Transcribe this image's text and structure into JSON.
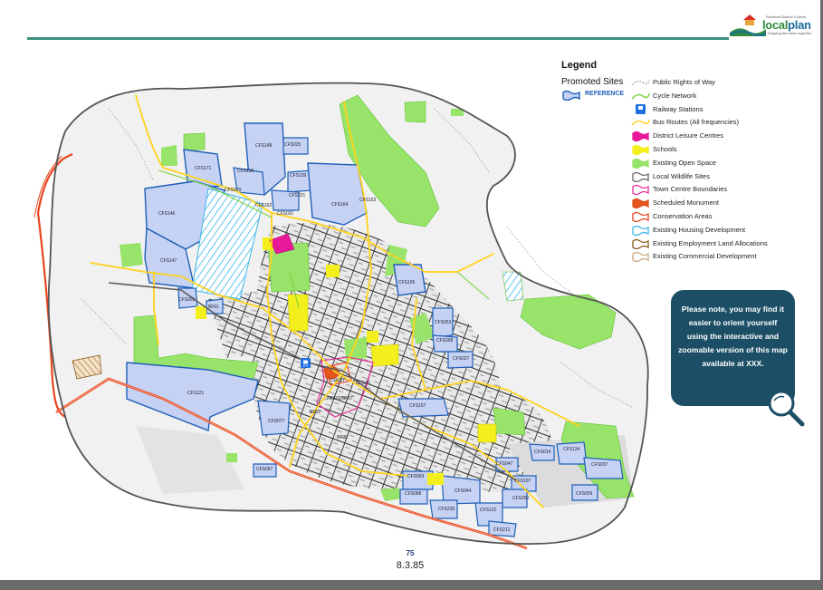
{
  "logo": {
    "tagline_top": "Rochford District Council",
    "wordmark_a": "local",
    "wordmark_b": "plan",
    "tagline": "Shaping the future together"
  },
  "legend": {
    "title": "Legend",
    "promoted_sites_title": "Promoted Sites",
    "promoted_sites_ref": "REFERENCE",
    "items": [
      {
        "label": "Public Rights of Way",
        "symbol": "dotted-line",
        "color": "#9a9a9a"
      },
      {
        "label": "Cycle Network",
        "symbol": "line",
        "color": "#7ad13a"
      },
      {
        "label": "Railway Stations",
        "symbol": "train-icon",
        "color": "#1f6fe0"
      },
      {
        "label": "Bus Routes (All frequencies)",
        "symbol": "line",
        "color": "#ffd21a"
      },
      {
        "label": "District Leisure Centres",
        "symbol": "area",
        "color": "#e8189a"
      },
      {
        "label": "Schools",
        "symbol": "area",
        "color": "#f3ef1c"
      },
      {
        "label": "Existing Open Space",
        "symbol": "area",
        "color": "#98e46a"
      },
      {
        "label": "Local Wildlife Sites",
        "symbol": "outline",
        "color": "#666666"
      },
      {
        "label": "Town Centre Boundaries",
        "symbol": "outline",
        "color": "#e52c9a"
      },
      {
        "label": "Scheduled Monument",
        "symbol": "area",
        "color": "#e0561e"
      },
      {
        "label": "Conservation Areas",
        "symbol": "outline",
        "color": "#e8451f"
      },
      {
        "label": "Existing Housing Development",
        "symbol": "outline",
        "color": "#3bb4e8"
      },
      {
        "label": "Existing Employment Land Allocations",
        "symbol": "outline",
        "color": "#8a5a1e"
      },
      {
        "label": "Existing Commercial Development",
        "symbol": "outline",
        "color": "#c8a880"
      }
    ]
  },
  "sites": [
    {
      "ref": "CFS148"
    },
    {
      "ref": "CFS025"
    },
    {
      "ref": "CFS171"
    },
    {
      "ref": "CFS136"
    },
    {
      "ref": "CFS139"
    },
    {
      "ref": "CFS170"
    },
    {
      "ref": "CFS221"
    },
    {
      "ref": "CFS162"
    },
    {
      "ref": "CFS164"
    },
    {
      "ref": "CFS163"
    },
    {
      "ref": "CFS146"
    },
    {
      "ref": "CFS031"
    },
    {
      "ref": "CFS147"
    },
    {
      "ref": "CFS105"
    },
    {
      "ref": "CFS001"
    },
    {
      "ref": "BF01"
    },
    {
      "ref": "CFS053"
    },
    {
      "ref": "CFS098"
    },
    {
      "ref": "CFS027"
    },
    {
      "ref": "COL07"
    },
    {
      "ref": "COL20"
    },
    {
      "ref": "CFS121"
    },
    {
      "ref": "REF03/BF07"
    },
    {
      "ref": "CFS157"
    },
    {
      "ref": "BF02"
    },
    {
      "ref": "CFS077"
    },
    {
      "ref": "BF05"
    },
    {
      "ref": "CFS134"
    },
    {
      "ref": "CFS014"
    },
    {
      "ref": "CFS037"
    },
    {
      "ref": "CFS087"
    },
    {
      "ref": "CFS047"
    },
    {
      "ref": "CFS069"
    },
    {
      "ref": "CFS107"
    },
    {
      "ref": "CFS068"
    },
    {
      "ref": "CFS044"
    },
    {
      "ref": "CFS250"
    },
    {
      "ref": "CFS059"
    },
    {
      "ref": "CFS236"
    },
    {
      "ref": "CFS122"
    },
    {
      "ref": "CFS212"
    }
  ],
  "callout": {
    "text": "Please note, you may find it easier to orient yourself using the interactive and zoomable version of this map available at XXX."
  },
  "footer": {
    "page_number": "75",
    "section_number": "8.3.85"
  }
}
